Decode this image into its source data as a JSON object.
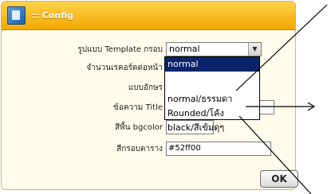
{
  "dialog": {
    "title": ":: Config"
  },
  "fields": [
    {
      "label": "รูปแบบ Template กรอบ",
      "value": "normal"
    },
    {
      "label": "จำนวนเรคอร์ดต่อหน้า"
    },
    {
      "label": "แบบอักษร"
    },
    {
      "label": "ข้อความ Title"
    },
    {
      "label": "สีพื้น bgcolor"
    },
    {
      "label": "สีกรอบตาราง",
      "value": "#52ff00"
    }
  ],
  "dropdown": {
    "options": [
      "normal",
      "",
      "normal/ธรรมดา",
      "Rounded/โค้ง",
      "black/สีเข้มดุๆ"
    ],
    "selected": "normal"
  },
  "ok_button": {
    "label": "OK"
  },
  "icons": {
    "app": "config-app-icon",
    "select_arrow": "chevron-down-icon"
  }
}
